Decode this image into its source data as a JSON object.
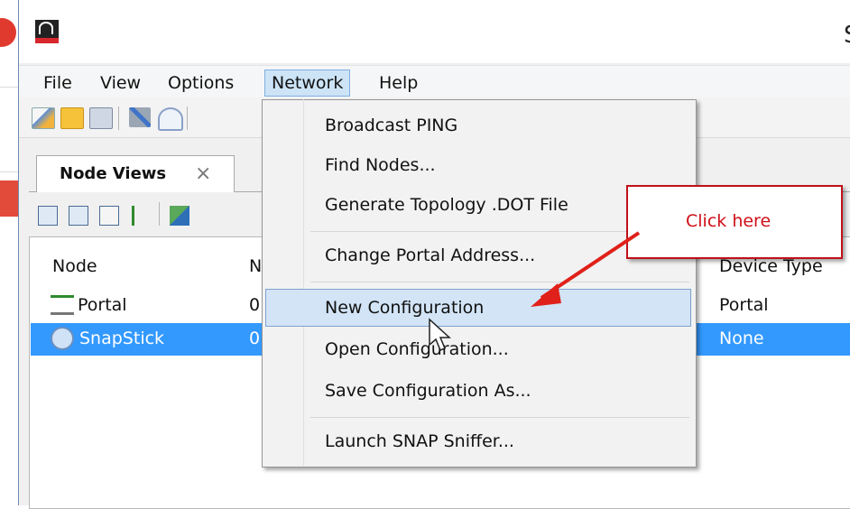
{
  "window": {
    "title_fragment": "S"
  },
  "menubar": {
    "items": [
      "File",
      "View",
      "Options",
      "Network",
      "Help"
    ],
    "active": "Network"
  },
  "toolbar": {
    "icons": [
      "edit-icon",
      "folder-icon",
      "copy-icon",
      "plug-icon",
      "antenna-icon"
    ]
  },
  "node_views": {
    "tab_label": "Node Views",
    "tab_close": "×",
    "columns": [
      "Node",
      "N",
      "Device Type"
    ],
    "rows": [
      {
        "node": "Portal",
        "n": "0",
        "device_type": "Portal",
        "selected": false,
        "icon": "portal-icon"
      },
      {
        "node": "SnapStick",
        "n": "0",
        "device_type": "None",
        "selected": true,
        "icon": "snapstick-icon"
      }
    ]
  },
  "network_menu": {
    "items": [
      {
        "label": "Broadcast PING",
        "bold": true
      },
      {
        "label": "Find Nodes..."
      },
      {
        "label": "Generate Topology .DOT File"
      },
      {
        "label": "Change Portal Address..."
      },
      {
        "label": "New Configuration",
        "highlighted": true
      },
      {
        "label": "Open Configuration..."
      },
      {
        "label": "Save Configuration As..."
      },
      {
        "label": "Launch SNAP Sniffer..."
      }
    ]
  },
  "callout": {
    "text": "Click here",
    "color": "#d01018"
  },
  "colors": {
    "selection": "#3399ff",
    "menu_highlight": "#d2e4f6",
    "callout_border": "#c0101a"
  }
}
